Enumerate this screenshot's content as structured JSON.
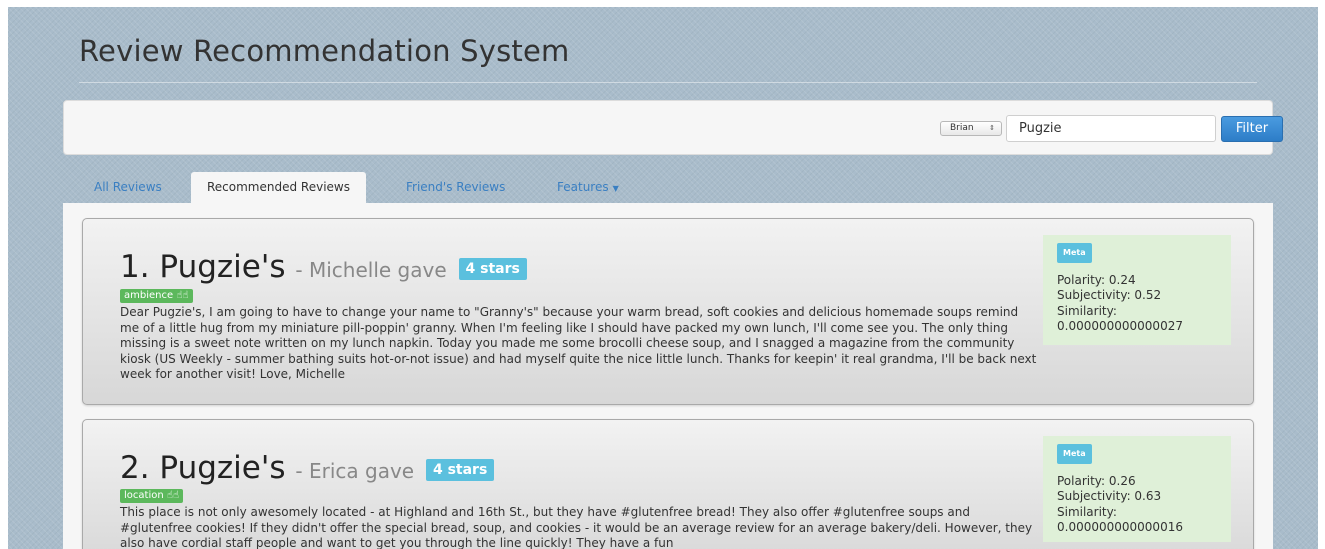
{
  "header": {
    "title": "Review Recommendation System"
  },
  "filter": {
    "user_selected": "Brian",
    "search_value": "Pugzie",
    "filter_label": "Filter"
  },
  "tabs": [
    {
      "label": "All Reviews",
      "active": false
    },
    {
      "label": "Recommended Reviews",
      "active": true
    },
    {
      "label": "Friend's Reviews",
      "active": false
    },
    {
      "label": "Features",
      "active": false,
      "dropdown": true
    }
  ],
  "reviews": [
    {
      "title": "1. Pugzie's",
      "author": "- Michelle gave",
      "stars": "4 stars",
      "feature": "ambience",
      "text": "Dear Pugzie's, I am going to have to change your name to \"Granny's\" because your warm bread, soft cookies and delicious homemade soups remind me of a little hug from my miniature pill-poppin' granny. When I'm feeling like I should have packed my own lunch, I'll come see you. The only thing missing is a sweet note written on my lunch napkin. Today you made me some brocolli cheese soup, and I snagged a magazine from the community kiosk (US Weekly - summer bathing suits hot-or-not issue) and had myself quite the nice little lunch. Thanks for keepin' it real grandma, I'll be back next week for another visit! Love, Michelle",
      "meta": {
        "label": "Meta",
        "polarity": "Polarity: 0.24",
        "subjectivity": "Subjectivity: 0.52",
        "similarity_label": "Similarity:",
        "similarity_value": "0.000000000000027"
      }
    },
    {
      "title": "2. Pugzie's",
      "author": "- Erica gave",
      "stars": "4 stars",
      "feature": "location",
      "text": "This place is not only awesomely located - at Highland and 16th St., but they have #glutenfree bread! They also offer #glutenfree soups and #glutenfree cookies! If they didn't offer the special bread, soup, and cookies - it would be an average review for an average bakery/deli. However, they also have cordial staff people and want to get you through the line quickly! They have a fun",
      "meta": {
        "label": "Meta",
        "polarity": "Polarity: 0.26",
        "subjectivity": "Subjectivity: 0.63",
        "similarity_label": "Similarity:",
        "similarity_value": "0.000000000000016"
      }
    }
  ],
  "icons": {
    "thumbs": "thumbs-up-icon",
    "select_arrows": "updown-arrows-icon",
    "dropdown_caret": "caret-down-icon"
  },
  "colors": {
    "accent": "#3a7fc2",
    "button": "#2d7dc7",
    "stars_badge": "#5bc0de",
    "feature_tag": "#5cb85c",
    "meta_bg": "#dff0d8"
  }
}
